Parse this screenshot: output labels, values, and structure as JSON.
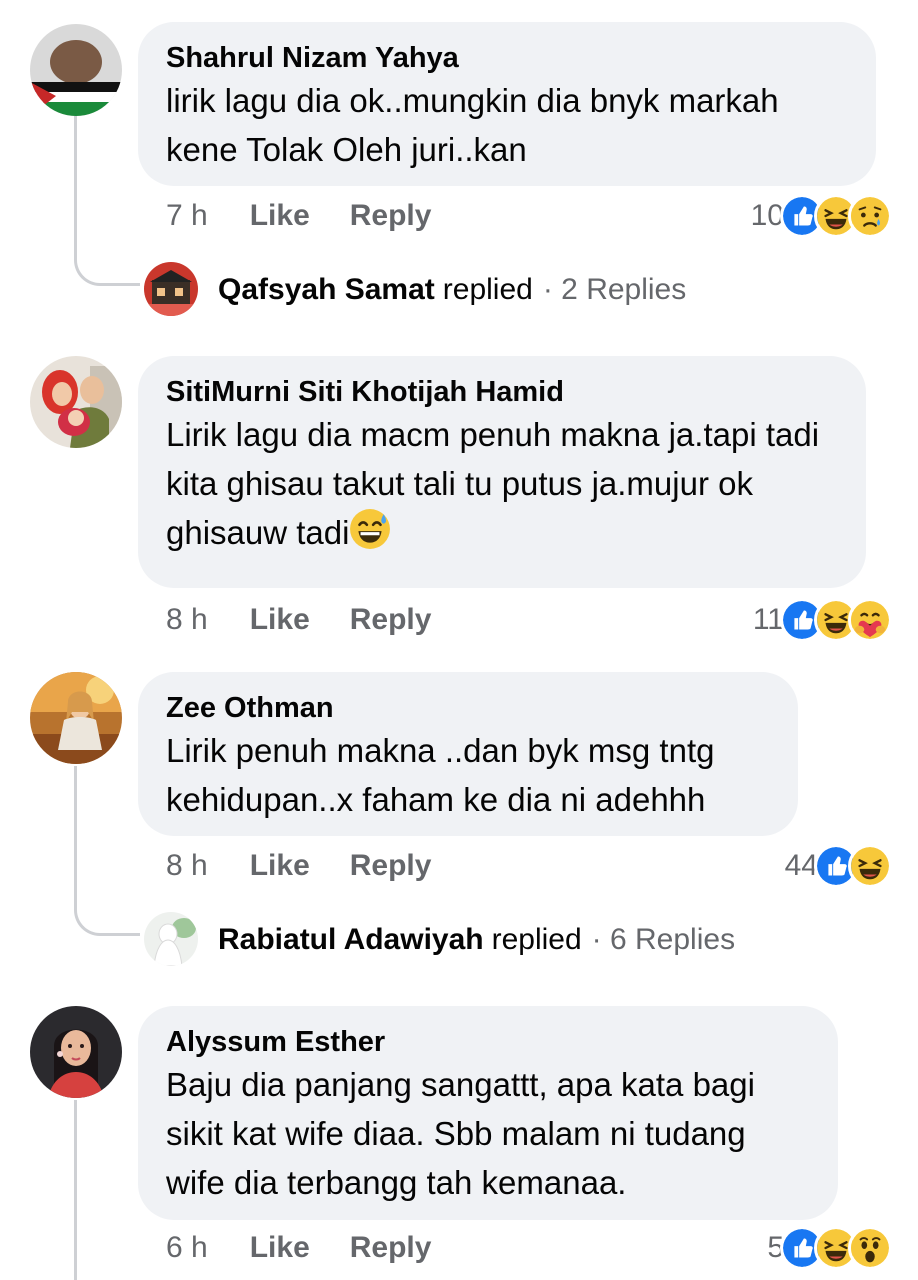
{
  "comments": [
    {
      "author": "Shahrul Nizam Yahya",
      "text": "lirik lagu dia ok..mungkin dia  bnyk markah kene Tolak Oleh juri..kan",
      "time": "7 h",
      "like_label": "Like",
      "reply_label": "Reply",
      "reaction_count": "10",
      "reactions": [
        "like-icon",
        "laughing-icon",
        "sad-icon"
      ],
      "replies": {
        "name": "Qafsyah Samat",
        "word": "replied",
        "count": "· 2 Replies"
      }
    },
    {
      "author": "SitiMurni Siti Khotijah Hamid",
      "text": "Lirik lagu dia macm penuh makna ja.tapi tadi kita ghisau takut tali tu putus ja.mujur ok ghisauw tadi",
      "time": "8 h",
      "like_label": "Like",
      "reply_label": "Reply",
      "reaction_count": "11",
      "reactions": [
        "like-icon",
        "laughing-icon",
        "care-icon"
      ]
    },
    {
      "author": "Zee Othman",
      "text": "Lirik penuh makna ..dan byk msg tntg kehidupan..x faham ke dia ni adehhh",
      "time": "8 h",
      "like_label": "Like",
      "reply_label": "Reply",
      "reaction_count": "44",
      "reactions": [
        "like-icon",
        "laughing-icon"
      ],
      "replies": {
        "name": "Rabiatul Adawiyah",
        "word": "replied",
        "count": "· 6 Replies"
      }
    },
    {
      "author": "Alyssum Esther",
      "text": "Baju dia panjang sangattt, apa kata bagi sikit kat wife diaa. Sbb malam ni tudang wife dia terbangg tah kemanaa.",
      "time": "6 h",
      "like_label": "Like",
      "reply_label": "Reply",
      "reaction_count": "5",
      "reactions": [
        "like-icon",
        "laughing-icon",
        "wow-icon"
      ]
    }
  ],
  "colors": {
    "bubble": "#f0f2f5",
    "meta": "#65676b",
    "like_blue": "#1877f2",
    "emoji_yellow": "#f7c83a"
  }
}
